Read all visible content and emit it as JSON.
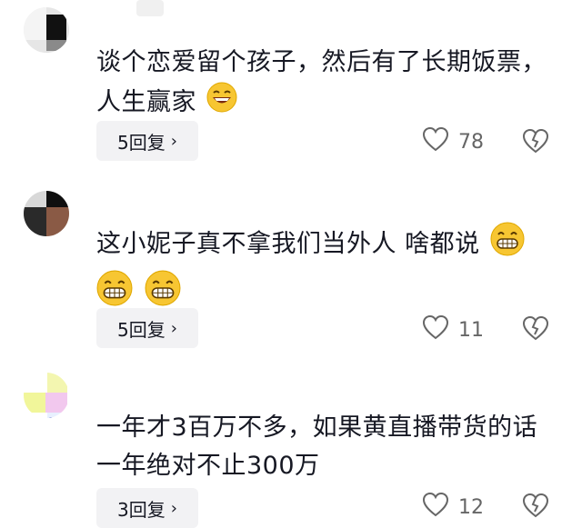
{
  "comments": [
    {
      "line1": "谈个恋爱留个孩子，然后有了长期饭票，",
      "line2": "人生赢家",
      "emoji": "laughing-emoji",
      "reply_label": "5回复",
      "like_count": "78"
    },
    {
      "line1": "这小妮子真不拿我们当外人 啥都说",
      "emoji": "grinning-emoji",
      "reply_label": "5回复",
      "like_count": "11"
    },
    {
      "line1": "一年才3百万不多，如果黄直播带货的话",
      "line2": "一年绝对不止300万",
      "reply_label": "3回复",
      "like_count": "12"
    }
  ],
  "icons": {
    "like": "heart-outline-icon",
    "dislike": "broken-heart-icon",
    "reply_chevron": "chevron-right-icon"
  },
  "colors": {
    "reply_bg": "#f2f2f4",
    "emoji_yellow": "#f7c632",
    "meta_gray": "#666666"
  }
}
